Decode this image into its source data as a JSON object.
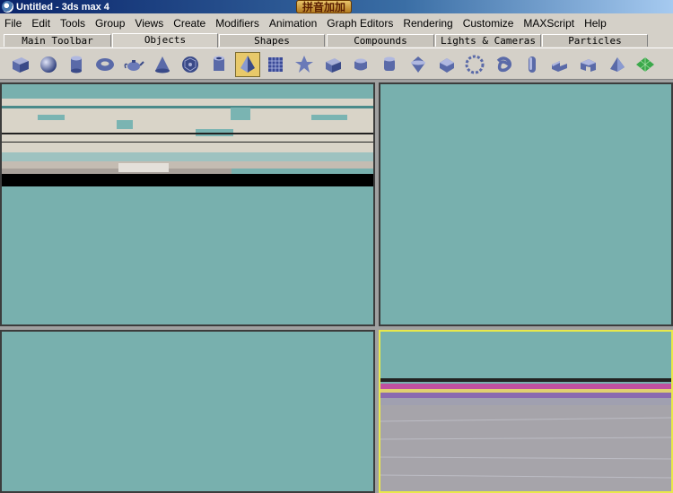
{
  "window": {
    "title": "Untitled - 3ds max 4",
    "badge": "拼音加加"
  },
  "menu": [
    "File",
    "Edit",
    "Tools",
    "Group",
    "Views",
    "Create",
    "Modifiers",
    "Animation",
    "Graph Editors",
    "Rendering",
    "Customize",
    "MAXScript",
    "Help"
  ],
  "tabs": [
    {
      "label": "Main Toolbar",
      "active": false
    },
    {
      "label": "Objects",
      "active": true
    },
    {
      "label": "Shapes",
      "active": false
    },
    {
      "label": "Compounds",
      "active": false
    },
    {
      "label": "Lights & Cameras",
      "active": false
    },
    {
      "label": "Particles",
      "active": false
    }
  ],
  "tools": [
    {
      "icon": "box-icon"
    },
    {
      "icon": "sphere-icon"
    },
    {
      "icon": "cylinder-icon"
    },
    {
      "icon": "torus-icon"
    },
    {
      "icon": "teapot-icon"
    },
    {
      "icon": "cone-icon"
    },
    {
      "icon": "geosphere-icon"
    },
    {
      "icon": "tube-icon"
    },
    {
      "icon": "pyramid-icon",
      "active": true
    },
    {
      "icon": "plane-icon"
    },
    {
      "icon": "hedra-icon"
    },
    {
      "icon": "chamfer-box-icon"
    },
    {
      "icon": "oil-tank-icon"
    },
    {
      "icon": "chamfer-cylinder-icon"
    },
    {
      "icon": "spindle-icon"
    },
    {
      "icon": "gengon-icon"
    },
    {
      "icon": "ringwave-icon"
    },
    {
      "icon": "torus-knot-icon"
    },
    {
      "icon": "capsule-icon"
    },
    {
      "icon": "l-ext-icon"
    },
    {
      "icon": "c-ext-icon"
    },
    {
      "icon": "prism-icon"
    },
    {
      "icon": "tile-grid-icon"
    }
  ],
  "viewports": [
    {
      "name": "top-left-viewport",
      "active": false
    },
    {
      "name": "top-right-viewport",
      "active": false
    },
    {
      "name": "bottom-left-viewport",
      "active": false
    },
    {
      "name": "bottom-right-viewport",
      "active": true
    }
  ],
  "colors": {
    "viewport_bg": "#78b0ae",
    "active_border": "#e8e84a",
    "title_bar": "#0a246a",
    "toolbar_bg": "#d4d0c8"
  }
}
